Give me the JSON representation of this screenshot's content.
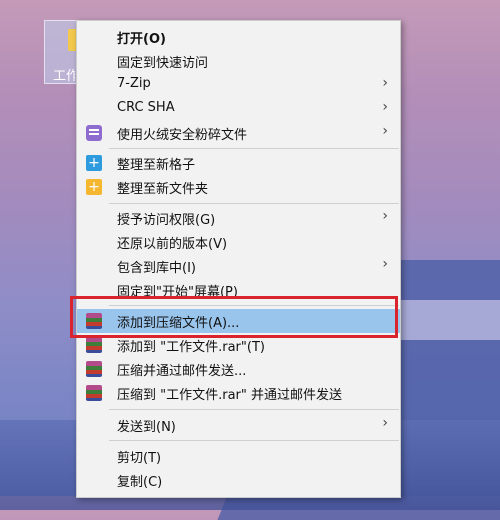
{
  "desktop": {
    "icon_label": "工作文件",
    "folder_icon": "folder-icon"
  },
  "menu": {
    "items": [
      {
        "label": "打开(O)",
        "bold": true
      },
      {
        "label": "固定到快速访问"
      },
      {
        "label": "7-Zip",
        "submenu": true
      },
      {
        "label": "CRC SHA",
        "submenu": true
      },
      {
        "label": "使用火绒安全粉碎文件",
        "submenu": true,
        "icon": "shredder-icon"
      },
      {
        "label": "整理至新格子",
        "icon": "add-blue-icon"
      },
      {
        "label": "整理至新文件夹",
        "icon": "add-yellow-icon"
      },
      {
        "label": "授予访问权限(G)",
        "submenu": true
      },
      {
        "label": "还原以前的版本(V)"
      },
      {
        "label": "包含到库中(I)",
        "submenu": true
      },
      {
        "label": "固定到\"开始\"屏幕(P)"
      },
      {
        "label": "添加到压缩文件(A)...",
        "icon": "winrar-icon",
        "highlighted": true
      },
      {
        "label": "添加到 \"工作文件.rar\"(T)",
        "icon": "winrar-icon"
      },
      {
        "label": "压缩并通过邮件发送...",
        "icon": "winrar-icon"
      },
      {
        "label": "压缩到 \"工作文件.rar\" 并通过邮件发送",
        "icon": "winrar-icon"
      },
      {
        "label": "发送到(N)",
        "submenu": true
      },
      {
        "label": "剪切(T)"
      },
      {
        "label": "复制(C)"
      }
    ],
    "submenu_arrow": "›",
    "plus_glyph": "+"
  },
  "colors": {
    "highlight": "#99c4ec",
    "callout_border": "#d9242d"
  }
}
